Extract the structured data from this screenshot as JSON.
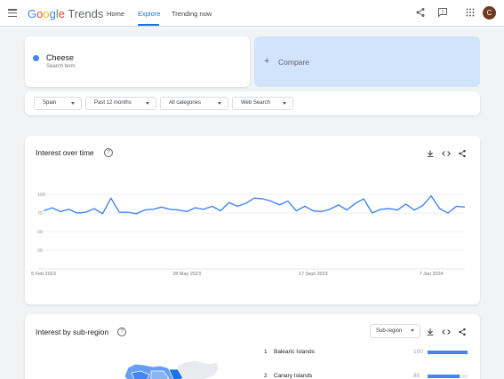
{
  "header": {
    "logo_google": "Google",
    "logo_trends": "Trends",
    "nav": [
      {
        "label": "Home",
        "active": false
      },
      {
        "label": "Explore",
        "active": true
      },
      {
        "label": "Trending now",
        "active": false
      }
    ],
    "icons": [
      "share-icon",
      "feedback-icon",
      "apps-icon"
    ],
    "avatar_letter": "C"
  },
  "search": {
    "term": "Cheese",
    "term_sub": "Search term",
    "compare_label": "Compare",
    "term_color": "#4285f4"
  },
  "filters": [
    {
      "label": "Spain"
    },
    {
      "label": "Past 12 months"
    },
    {
      "label": "All categories"
    },
    {
      "label": "Web Search"
    }
  ],
  "interest_over_time": {
    "title": "Interest over time",
    "chart_data": {
      "type": "line",
      "x_ticks": [
        "5 Feb 2023",
        "28 May 2023",
        "17 Sept 2023",
        "7 Jan 2024"
      ],
      "y_ticks": [
        100,
        75,
        50,
        25
      ],
      "ylim": [
        0,
        100
      ],
      "series": [
        {
          "values": [
            78,
            82,
            77,
            80,
            75,
            76,
            81,
            74,
            95,
            76,
            76,
            74,
            79,
            80,
            83,
            80,
            79,
            77,
            82,
            80,
            84,
            78,
            89,
            84,
            88,
            95,
            94,
            91,
            86,
            91,
            78,
            84,
            78,
            77,
            80,
            86,
            79,
            88,
            94,
            75,
            80,
            81,
            79,
            87,
            79,
            85,
            98,
            81,
            75,
            84,
            83
          ]
        }
      ],
      "grid": true,
      "color": "#4285f4"
    }
  },
  "sub_region": {
    "title": "Interest by sub-region",
    "select_label": "Sub-region",
    "rows": [
      {
        "rank": "1",
        "name": "Balearic Islands",
        "value": 100
      },
      {
        "rank": "2",
        "name": "Canary Islands",
        "value": 80
      }
    ]
  }
}
